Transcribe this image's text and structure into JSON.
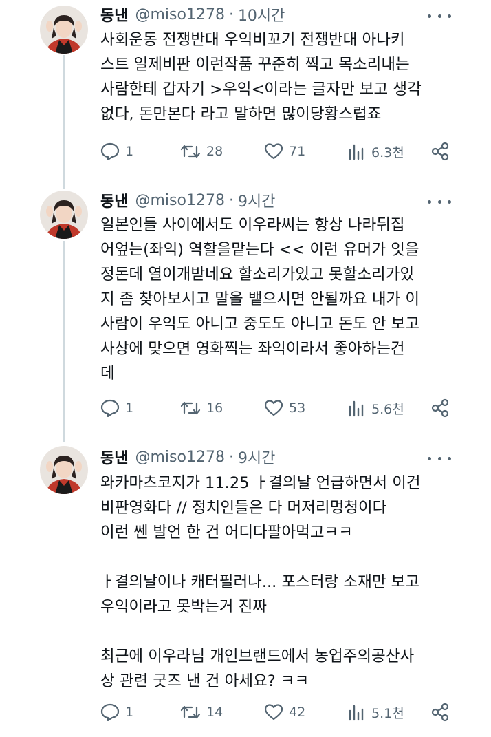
{
  "tweets": [
    {
      "name": "동낸",
      "handle": "@miso1278",
      "separator": "·",
      "time": "10시간",
      "lines": [
        "사회운동 전쟁반대 우익비꼬기 전쟁반대 아나키",
        "스트 일제비판 이런작품 꾸준히 찍고 목소리내는",
        "사람한테 갑자기 >우익<이라는 글자만 보고 생각",
        "없다, 돈만본다 라고 말하면 많이당황스럽죠"
      ],
      "replies": "1",
      "retweets": "28",
      "likes": "71",
      "views": "6.3천"
    },
    {
      "name": "동낸",
      "handle": "@miso1278",
      "separator": "·",
      "time": "9시간",
      "lines": [
        "일본인들 사이에서도 이우라씨는 항상 나라뒤집",
        "어엎는(좌익) 역할을맡는다 << 이런 유머가 잇을",
        "정돈데 열이개받네요 할소리가있고 못할소리가있",
        "지 좀 찾아보시고 말을 뱉으시면 안될까요 내가 이",
        "사람이 우익도 아니고 중도도 아니고 돈도 안 보고",
        "사상에 맞으면 영화찍는 좌익이라서 좋아하는건",
        "데"
      ],
      "replies": "1",
      "retweets": "16",
      "likes": "53",
      "views": "5.6천"
    },
    {
      "name": "동낸",
      "handle": "@miso1278",
      "separator": "·",
      "time": "9시간",
      "lines": [
        "와카마츠코지가 11.25 ㅏ결의날 언급하면서 이건",
        "비판영화다 // 정치인들은 다 머저리멍청이다",
        "이런 쎈 발언 한 건 어디다팔아먹고ㅋㅋ",
        "",
        "ㅏ결의날이나 캐터필러나... 포스터랑 소재만 보고",
        "우익이라고 못박는거 진짜",
        "",
        "최근에 이우라님 개인브랜드에서 농업주의공산사",
        "상 관련 굿즈 낸 건 아세요? ㅋㅋ"
      ],
      "replies": "1",
      "retweets": "14",
      "likes": "42",
      "views": "5.1천"
    }
  ],
  "icons": {
    "reply": "reply-icon",
    "retweet": "retweet-icon",
    "like": "heart-icon",
    "views": "views-chart-icon",
    "share": "share-icon",
    "more": "more-icon"
  },
  "colors": {
    "text": "#0f1419",
    "muted": "#536471",
    "thread_line": "#cfd9de"
  }
}
